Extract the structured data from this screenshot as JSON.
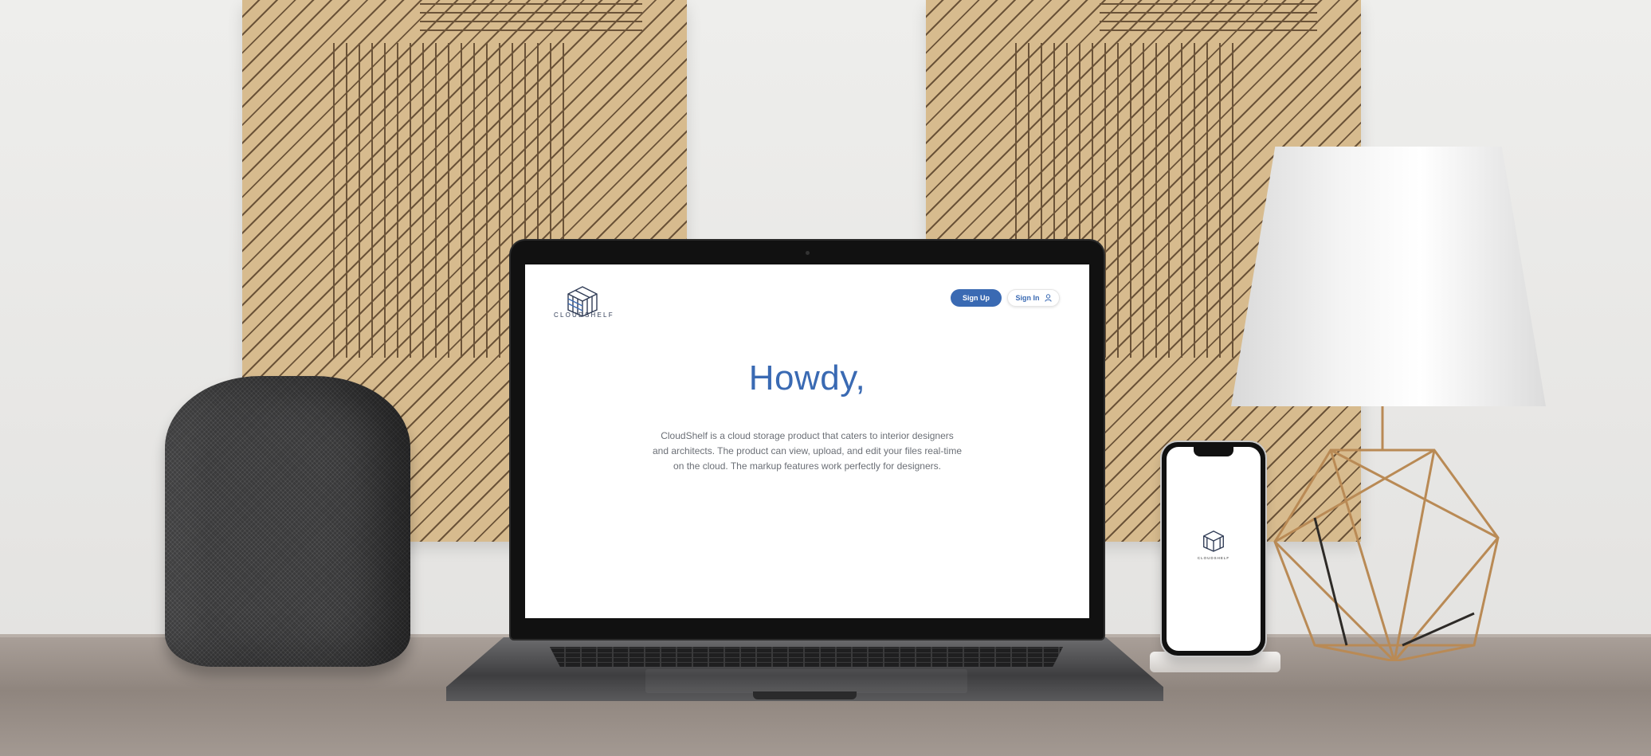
{
  "website": {
    "logo_text": "CLOUDSHELF",
    "signup_label": "Sign Up",
    "signin_label": "Sign In",
    "heading": "Howdy,",
    "description": "CloudShelf is a cloud storage product that caters to interior designers and architects. The product can view, upload, and edit your files real-time on the cloud. The markup features work perfectly for designers."
  },
  "phone": {
    "logo_text": "CLOUDSHELF"
  },
  "colors": {
    "brand_blue": "#3a6ab3",
    "logo_navy": "#2f3b55",
    "body_text": "#6b6f76"
  },
  "icons": {
    "signin": "user-icon",
    "logo": "cube-logo-icon"
  }
}
